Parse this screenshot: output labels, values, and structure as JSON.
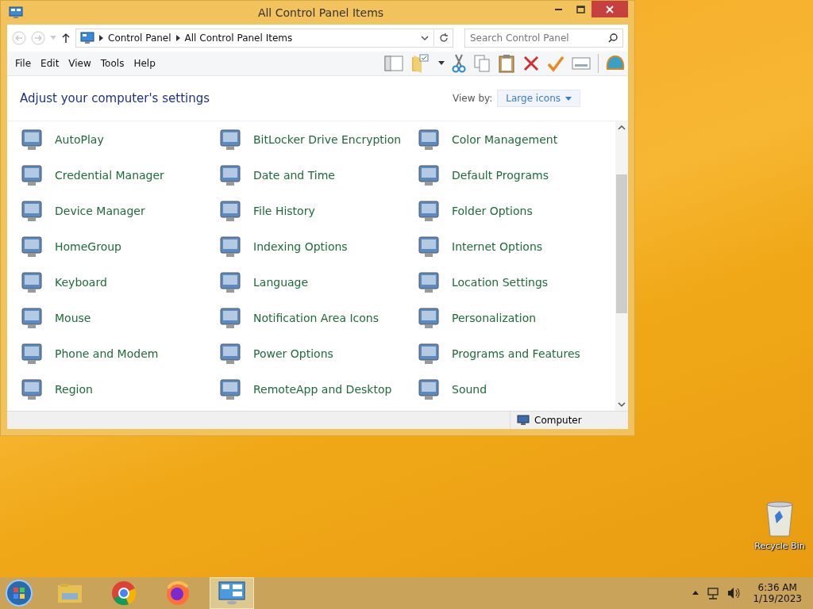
{
  "window": {
    "title": "All Control Panel Items"
  },
  "address": {
    "crumbs": [
      "Control Panel",
      "All Control Panel Items"
    ],
    "search_placeholder": "Search Control Panel"
  },
  "menu": [
    "File",
    "Edit",
    "View",
    "Tools",
    "Help"
  ],
  "header": {
    "title": "Adjust your computer's settings",
    "view_by_label": "View by:",
    "view_by_value": "Large icons"
  },
  "items": [
    {
      "label": "AutoPlay"
    },
    {
      "label": "BitLocker Drive Encryption"
    },
    {
      "label": "Color Management"
    },
    {
      "label": "Credential Manager"
    },
    {
      "label": "Date and Time"
    },
    {
      "label": "Default Programs"
    },
    {
      "label": "Device Manager"
    },
    {
      "label": "File History"
    },
    {
      "label": "Folder Options"
    },
    {
      "label": "HomeGroup"
    },
    {
      "label": "Indexing Options"
    },
    {
      "label": "Internet Options"
    },
    {
      "label": "Keyboard"
    },
    {
      "label": "Language"
    },
    {
      "label": "Location Settings"
    },
    {
      "label": "Mouse"
    },
    {
      "label": "Notification Area Icons"
    },
    {
      "label": "Personalization"
    },
    {
      "label": "Phone and Modem"
    },
    {
      "label": "Power Options"
    },
    {
      "label": "Programs and Features"
    },
    {
      "label": "Region"
    },
    {
      "label": "RemoteApp and Desktop"
    },
    {
      "label": "Sound"
    }
  ],
  "status_bar": {
    "location": "Computer"
  },
  "desktop": {
    "icons": [
      {
        "label": "Recycle Bin"
      }
    ]
  },
  "taskbar": {
    "apps": [
      {
        "kind": "explorer",
        "selected": false
      },
      {
        "kind": "chrome",
        "selected": false
      },
      {
        "kind": "firefox",
        "selected": false
      },
      {
        "kind": "controlpanel",
        "selected": true
      }
    ],
    "time": "6:36 AM",
    "date": "1/19/2023"
  }
}
